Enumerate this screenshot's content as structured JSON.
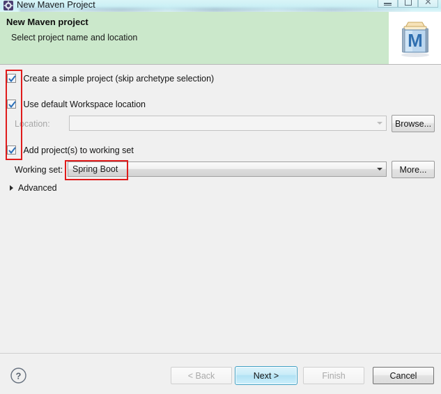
{
  "window": {
    "title": "New Maven Project",
    "icon": "eclipse-wizard-icon",
    "controls": {
      "minimize_label": "Minimize",
      "maximize_label": "Maximize",
      "close_label": "Close"
    }
  },
  "header": {
    "title": "New Maven project",
    "subtitle": "Select project name and location",
    "banner_icon": "maven-banner-icon",
    "banner_icon_letter": "M",
    "background_color": "#cbe8cb"
  },
  "form": {
    "simple_project": {
      "label": "Create a simple project (skip archetype selection)",
      "checked": true
    },
    "default_workspace": {
      "label": "Use default Workspace location",
      "checked": true
    },
    "location": {
      "label": "Location:",
      "value": "",
      "placeholder": "",
      "disabled": true,
      "browse_label": "Browse..."
    },
    "add_to_working_set": {
      "label": "Add project(s) to working set",
      "checked": true
    },
    "working_set": {
      "label": "Working set:",
      "value": "Spring Boot",
      "more_label": "More..."
    },
    "advanced": {
      "label": "Advanced",
      "expanded": false
    }
  },
  "footer": {
    "help_icon": "help-question-icon",
    "buttons": {
      "back": {
        "label": "< Back",
        "disabled": true
      },
      "next": {
        "label": "Next >",
        "disabled": false,
        "default": true
      },
      "finish": {
        "label": "Finish",
        "disabled": true
      },
      "cancel": {
        "label": "Cancel",
        "disabled": false
      }
    }
  },
  "annotations": {
    "color": "#e01b1b",
    "items": [
      {
        "name": "checkbox-column-highlight"
      },
      {
        "name": "working-set-value-highlight"
      }
    ]
  }
}
